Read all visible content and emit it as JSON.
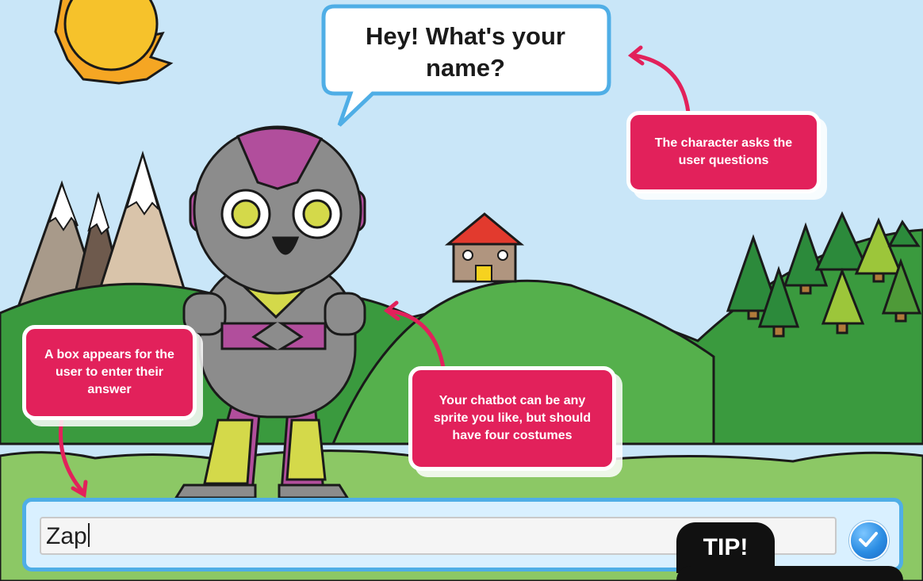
{
  "speech_bubble": {
    "text": "Hey! What's your name?"
  },
  "callouts": {
    "character": "The character asks the user questions",
    "answer_box": "A box appears for the user to enter their answer",
    "chatbot": "Your chatbot can be any sprite you like, but should have four costumes"
  },
  "answer": {
    "value": "Zap"
  },
  "submit": {
    "icon": "checkmark-icon"
  },
  "tip": {
    "label": "TIP!"
  },
  "colors": {
    "sky": "#c9e6f8",
    "grass": "#8cc865",
    "callout": "#e2215b",
    "bubble_border": "#4faee6",
    "robot_body": "#8c8c8c",
    "robot_accent": "#b14e9c"
  }
}
